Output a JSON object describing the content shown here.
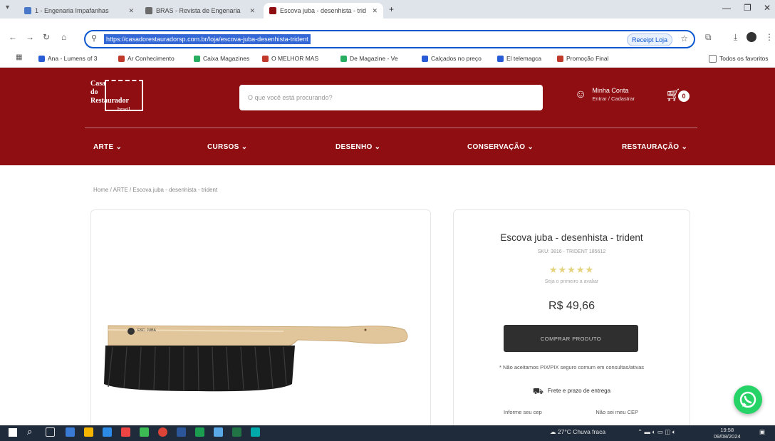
{
  "browser": {
    "tabs": [
      {
        "label": "1 - Engenaria Impafanhas",
        "active": false
      },
      {
        "label": "BRAS - Revista de Engenaria",
        "active": false
      },
      {
        "label": "Escova juba - desenhista - trid",
        "active": true
      }
    ],
    "new_tab": "+",
    "url": "https://casadorestauradorsp.com.br/loja/escova-juba-desenhista-trident",
    "profile_chip": "Receipt Loja",
    "bookmarks": [
      "Ana - Lumens of 3",
      "Ar Conhecimento",
      "Caixa Magazines",
      "O MELHOR MAS",
      "De Magazine - Ve",
      "Calçados no preço",
      "El telemagca",
      "Promoção Final"
    ],
    "bookmarks_right": "Todos os favoritos"
  },
  "site": {
    "logo_lines": [
      "Casa",
      "do",
      "Restaurador"
    ],
    "logo_sub": "brasil",
    "search_placeholder": "O que você está procurando?",
    "account_title": "Minha Conta",
    "account_sub": "Entrar / Cadastrar",
    "cart_count": "0",
    "menu": [
      "ARTE",
      "CURSOS",
      "DESENHO",
      "CONSERVAÇÃO",
      "RESTAURAÇÃO"
    ]
  },
  "product": {
    "breadcrumb": "Home / ARTE / Escova juba - desenhista - trident",
    "brush_label": "ESC. JUBA",
    "title": "Escova juba - desenhista - trident",
    "sku": "SKU: 3816 - TRIDENT 185612",
    "stars": "★★★★★",
    "reviews": "Seja o primeiro a avaliar",
    "price": "R$ 49,66",
    "buy_label": "COMPRAR PRODUTO",
    "note": "* Não aceitamos PIX/PIX seguro comum em consultas/ativas",
    "shipping_label": "Frete e prazo de entrega",
    "cep_label": "Informe seu cep",
    "cep_link": "Não sei meu CEP"
  },
  "taskbar": {
    "weather": "27°C Chuva fraca",
    "time": "19:58",
    "date": "09/08/2024"
  },
  "colors": {
    "brand": "#8f0e12",
    "button": "#2f2f2f",
    "star": "#e5d27c",
    "whatsapp": "#25d366"
  }
}
